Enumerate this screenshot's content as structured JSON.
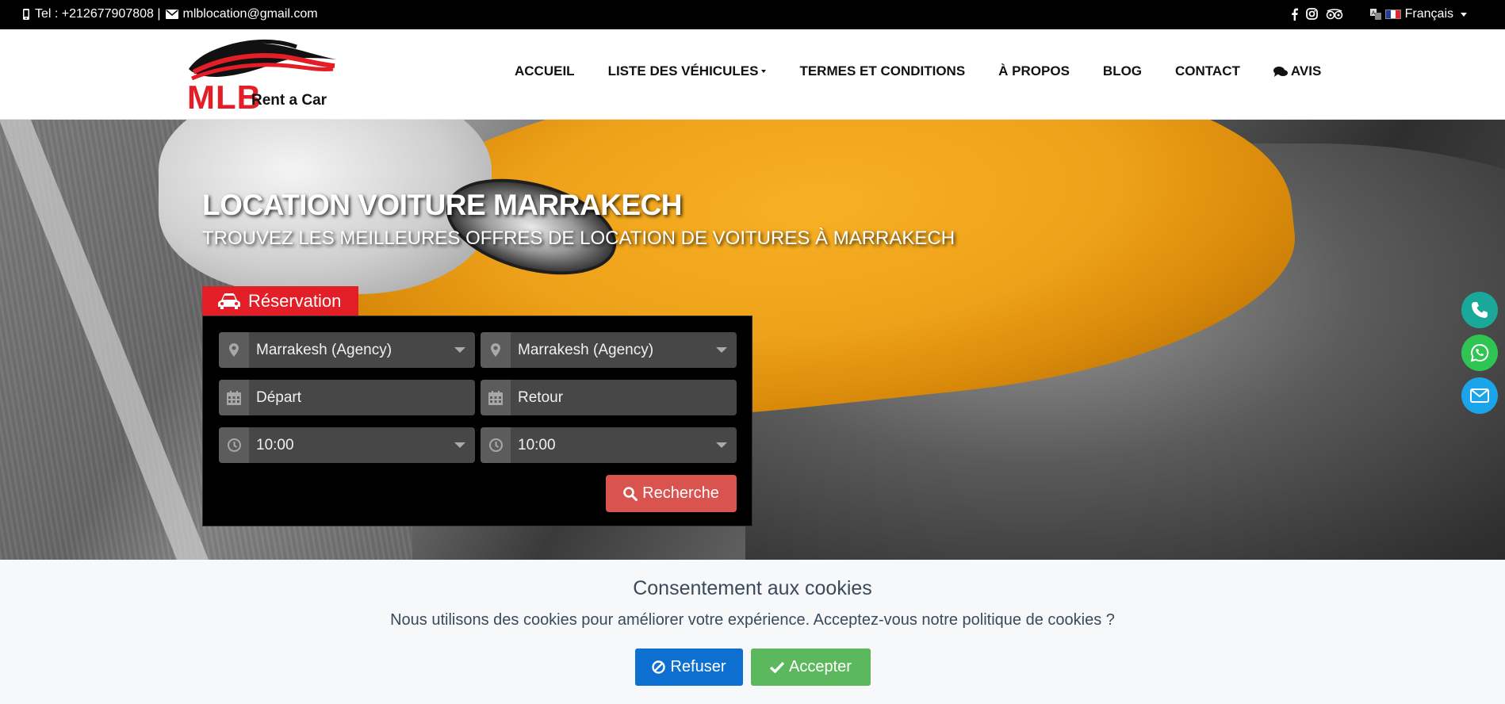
{
  "topbar": {
    "phone_label": "Tel : +212677907808 |",
    "email": "mlblocation@gmail.com",
    "language": "Français",
    "icons": [
      "mobile-phone-icon",
      "envelope-icon",
      "facebook-icon",
      "instagram-icon",
      "tripadvisor-icon",
      "translate-icon",
      "france-flag-icon"
    ]
  },
  "logo": {
    "brand": "MLB",
    "tagline": "Rent a Car"
  },
  "nav": {
    "items": [
      "ACCUEIL",
      "LISTE DES VÉHICULES",
      "TERMES ET CONDITIONS",
      "À PROPOS",
      "BLOG",
      "CONTACT",
      "AVIS"
    ]
  },
  "hero": {
    "title": "LOCATION VOITURE MARRAKECH",
    "subtitle": "TROUVEZ LES MEILLEURES OFFRES DE LOCATION DE VOITURES À MARRAKECH"
  },
  "reservation": {
    "tab_label": "Réservation",
    "pickup_location": "Marrakesh (Agency)",
    "return_location": "Marrakesh (Agency)",
    "departure_placeholder": "Départ",
    "return_placeholder": "Retour",
    "pickup_time": "10:00",
    "return_time": "10:00",
    "search_label": "Recherche"
  },
  "floating": {
    "icons": [
      "phone-icon",
      "whatsapp-icon",
      "email-icon"
    ]
  },
  "cookie": {
    "title": "Consentement aux cookies",
    "text": "Nous utilisons des cookies pour améliorer votre expérience. Acceptez-vous notre politique de cookies ?",
    "refuse_label": "Refuser",
    "accept_label": "Accepter"
  },
  "colors": {
    "brand_red": "#e41e26",
    "search_button": "#d9534f",
    "refuse_button": "#0d6fcf",
    "accept_button": "#5cb85c",
    "fab_phone": "#19a89a",
    "fab_whatsapp": "#2fc552",
    "fab_email": "#1aa5ea"
  }
}
